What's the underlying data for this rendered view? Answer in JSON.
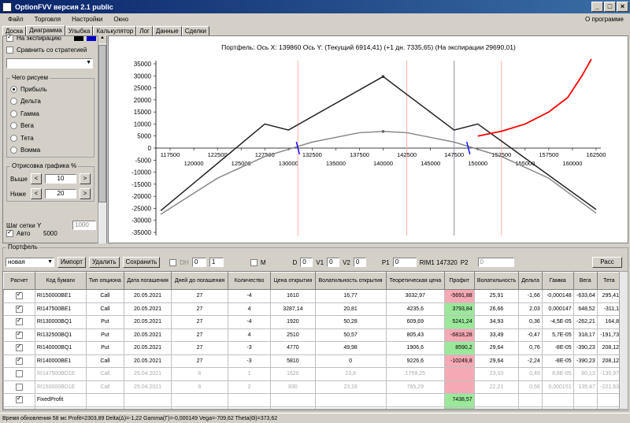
{
  "window": {
    "title": "OptionFVV версия 2.1 public"
  },
  "menu": {
    "items": [
      "Файл",
      "Торговля",
      "Настройки",
      "Окно"
    ],
    "about": "О программе"
  },
  "tabs": [
    "Доска",
    "Диаграмма",
    "Улыбка",
    "Калькулятор",
    "Лог",
    "Данные",
    "Сделки"
  ],
  "left": {
    "expiry_label": "На экспирацию",
    "compare_label": "Сравнить со стратегией",
    "group_draw": "Чего рисуем",
    "radios": [
      "Прибыль",
      "Дельта",
      "Гамма",
      "Вега",
      "Тета",
      "Вомма"
    ],
    "group_scale": "Отрисовка графика %",
    "above_label": "Выше",
    "above_value": "10",
    "below_label": "Ниже",
    "below_value": "20",
    "grid_step_label": "Шаг сетки Y",
    "grid_step_value": "1000",
    "auto_label": "Авто",
    "auto_value": "5000"
  },
  "chart_data": {
    "type": "line",
    "title": "Портфель: Ось X: 139860 Ось Y:  (Текущий 6914,41)  (+1 дн. 7335,65)  (На экспирации 29690,01)",
    "x_ticks_top": [
      "117500",
      "122500",
      "127500",
      "132500",
      "137500",
      "142500",
      "147500",
      "152500",
      "157500",
      "162500"
    ],
    "x_ticks_bottom": [
      "120000",
      "125000",
      "130000",
      "135000",
      "140000",
      "145000",
      "150000",
      "155000",
      "160000"
    ],
    "y_ticks": [
      "35000",
      "30000",
      "25000",
      "20000",
      "15000",
      "10000",
      "5000",
      "0",
      "-5000",
      "-10000",
      "-15000",
      "-20000",
      "-25000",
      "-30000",
      "-35000"
    ],
    "xlim": [
      116000,
      163000
    ],
    "ylim": [
      -35000,
      35000
    ],
    "series": [
      {
        "color": "#222222",
        "points": [
          [
            116500,
            -26000
          ],
          [
            127500,
            10000
          ],
          [
            130000,
            7500
          ],
          [
            140000,
            29700
          ],
          [
            147500,
            7500
          ],
          [
            150000,
            10000
          ],
          [
            162500,
            -25500
          ]
        ]
      },
      {
        "color": "#888888",
        "points": [
          [
            116500,
            -27500
          ],
          [
            122500,
            -12500
          ],
          [
            127500,
            -3500
          ],
          [
            132500,
            2500
          ],
          [
            137500,
            6400
          ],
          [
            140000,
            6900
          ],
          [
            142500,
            6400
          ],
          [
            147500,
            2500
          ],
          [
            152500,
            -3500
          ],
          [
            157500,
            -12500
          ],
          [
            162500,
            -27000
          ]
        ]
      },
      {
        "color": "#ff0000",
        "points": [
          [
            150000,
            5000
          ],
          [
            152500,
            7000
          ],
          [
            155000,
            10000
          ],
          [
            157500,
            15000
          ],
          [
            159500,
            21000
          ],
          [
            161000,
            30000
          ],
          [
            162000,
            37000
          ]
        ]
      }
    ],
    "vlines": [
      {
        "x": 131000,
        "color": "#ffb0b0"
      },
      {
        "x": 142500,
        "color": "#ffb0b0"
      },
      {
        "x": 147500,
        "color": "#9090a0"
      },
      {
        "x": 152500,
        "color": "#ffb0b0"
      }
    ]
  },
  "portfolio": {
    "group_label": "Портфель",
    "select_value": "новая",
    "import_btn": "Импорт",
    "delete_btn": "Удалить",
    "save_btn": "Сохранить",
    "dh_label": "DH",
    "dh_a": "0",
    "dh_b": "1",
    "m_label": "M",
    "d_label": "D",
    "d_value": "0",
    "v1_label": "V1",
    "v1_value": "0",
    "v2_label": "V2",
    "v2_value": "0",
    "p1_label": "P1",
    "p1_value": "0",
    "rim_label": "RIM1 147320",
    "p2_label": "P2",
    "p2_value": "0",
    "calc_btn": "Расс"
  },
  "table": {
    "headers": [
      "Расчет",
      "Код бумаги",
      "Тип опциона",
      "Дата погашения",
      "Дней до погашения",
      "Количество",
      "Цена открытия",
      "Волатильность открытия",
      "Теоретическая цена",
      "Профит",
      "Волатильность",
      "Дельта",
      "Гамма",
      "Вега",
      "Тета"
    ],
    "rows": [
      {
        "calc": true,
        "code": "RI150000BE1",
        "type": "Call",
        "date": "20.05.2021",
        "days": "27",
        "qty": "-4",
        "price": "1610",
        "vol_open": "16,77",
        "theo": "3032,97",
        "profit": "-5691,88",
        "pcls": "neg",
        "vol": "25,91",
        "delta": "-1,66",
        "gamma": "-0,000148",
        "vega": "-633,64",
        "theta": "295,41",
        "dis": false
      },
      {
        "calc": true,
        "code": "RI147500BE1",
        "type": "Call",
        "date": "20.05.2021",
        "days": "27",
        "qty": "4",
        "price": "3287,14",
        "vol_open": "20,81",
        "theo": "4235,6",
        "profit": "3793,84",
        "pcls": "pos",
        "vol": "26,66",
        "delta": "2,03",
        "gamma": "0,000147",
        "vega": "648,52",
        "theta": "-311,1",
        "dis": false
      },
      {
        "calc": true,
        "code": "RI130000BQ1",
        "type": "Put",
        "date": "20.05.2021",
        "days": "27",
        "qty": "-4",
        "price": "1920",
        "vol_open": "50,28",
        "theo": "609,69",
        "profit": "5241,24",
        "pcls": "pos",
        "vol": "34,93",
        "delta": "0,36",
        "gamma": "-4,5E-05",
        "vega": "-262,21",
        "theta": "164,8",
        "dis": false
      },
      {
        "calc": true,
        "code": "RI132500BQ1",
        "type": "Put",
        "date": "20.05.2021",
        "days": "27",
        "qty": "4",
        "price": "2510",
        "vol_open": "50,57",
        "theo": "805,43",
        "profit": "-6818,28",
        "pcls": "neg",
        "vol": "33,49",
        "delta": "-0,47",
        "gamma": "5,7E-05",
        "vega": "318,17",
        "theta": "-191,73",
        "dis": false
      },
      {
        "calc": true,
        "code": "RI140000BQ1",
        "type": "Put",
        "date": "20.05.2021",
        "days": "27",
        "qty": "-3",
        "price": "4770",
        "vol_open": "49,98",
        "theo": "1906,6",
        "profit": "8590,2",
        "pcls": "pos",
        "vol": "29,64",
        "delta": "0,76",
        "gamma": "-8E-05",
        "vega": "-390,23",
        "theta": "208,12",
        "dis": false
      },
      {
        "calc": true,
        "code": "RI140000BE1",
        "type": "Call",
        "date": "20.05.2021",
        "days": "27",
        "qty": "-3",
        "price": "5810",
        "vol_open": "0",
        "theo": "9226,6",
        "profit": "-10249,8",
        "pcls": "neg",
        "vol": "29,64",
        "delta": "-2,24",
        "gamma": "-8E-05",
        "vega": "-390,23",
        "theta": "208,12",
        "dis": false
      },
      {
        "calc": false,
        "code": "RI147500BD1E",
        "type": "Call",
        "date": "29.04.2021",
        "days": "6",
        "qty": "1",
        "price": "1620",
        "vol_open": "23,8",
        "theo": "1759,25",
        "profit": "",
        "pcls": "neg",
        "vol": "23,03",
        "delta": "0,49",
        "gamma": "8,6E-05",
        "vega": "80,13",
        "theta": "-135,97",
        "dis": true
      },
      {
        "calc": false,
        "code": "RI150000BD1E",
        "type": "Call",
        "date": "29.04.2021",
        "days": "6",
        "qty": "2",
        "price": "830",
        "vol_open": "23,16",
        "theo": "765,29",
        "profit": "",
        "pcls": "neg",
        "vol": "22,21",
        "delta": "0,56",
        "gamma": "0,000151",
        "vega": "135,47",
        "theta": "-221,63",
        "dis": true
      }
    ],
    "fixed_label": "FixedProfit",
    "fixed_value": "7438,57",
    "total_label": "Итого:",
    "total_profit": "2303,89",
    "total_delta": "-1,22",
    "total_gamma": "-0,000149",
    "total_vega": "-709,62",
    "total_theta": "373,62"
  },
  "status": "Время обновления 58 мс  Profit=2303,89 Delta(Δ)=-1,22 Gamma(Γ)=-0,000149 Vega=-709,62 Theta(Θ)=373,62"
}
